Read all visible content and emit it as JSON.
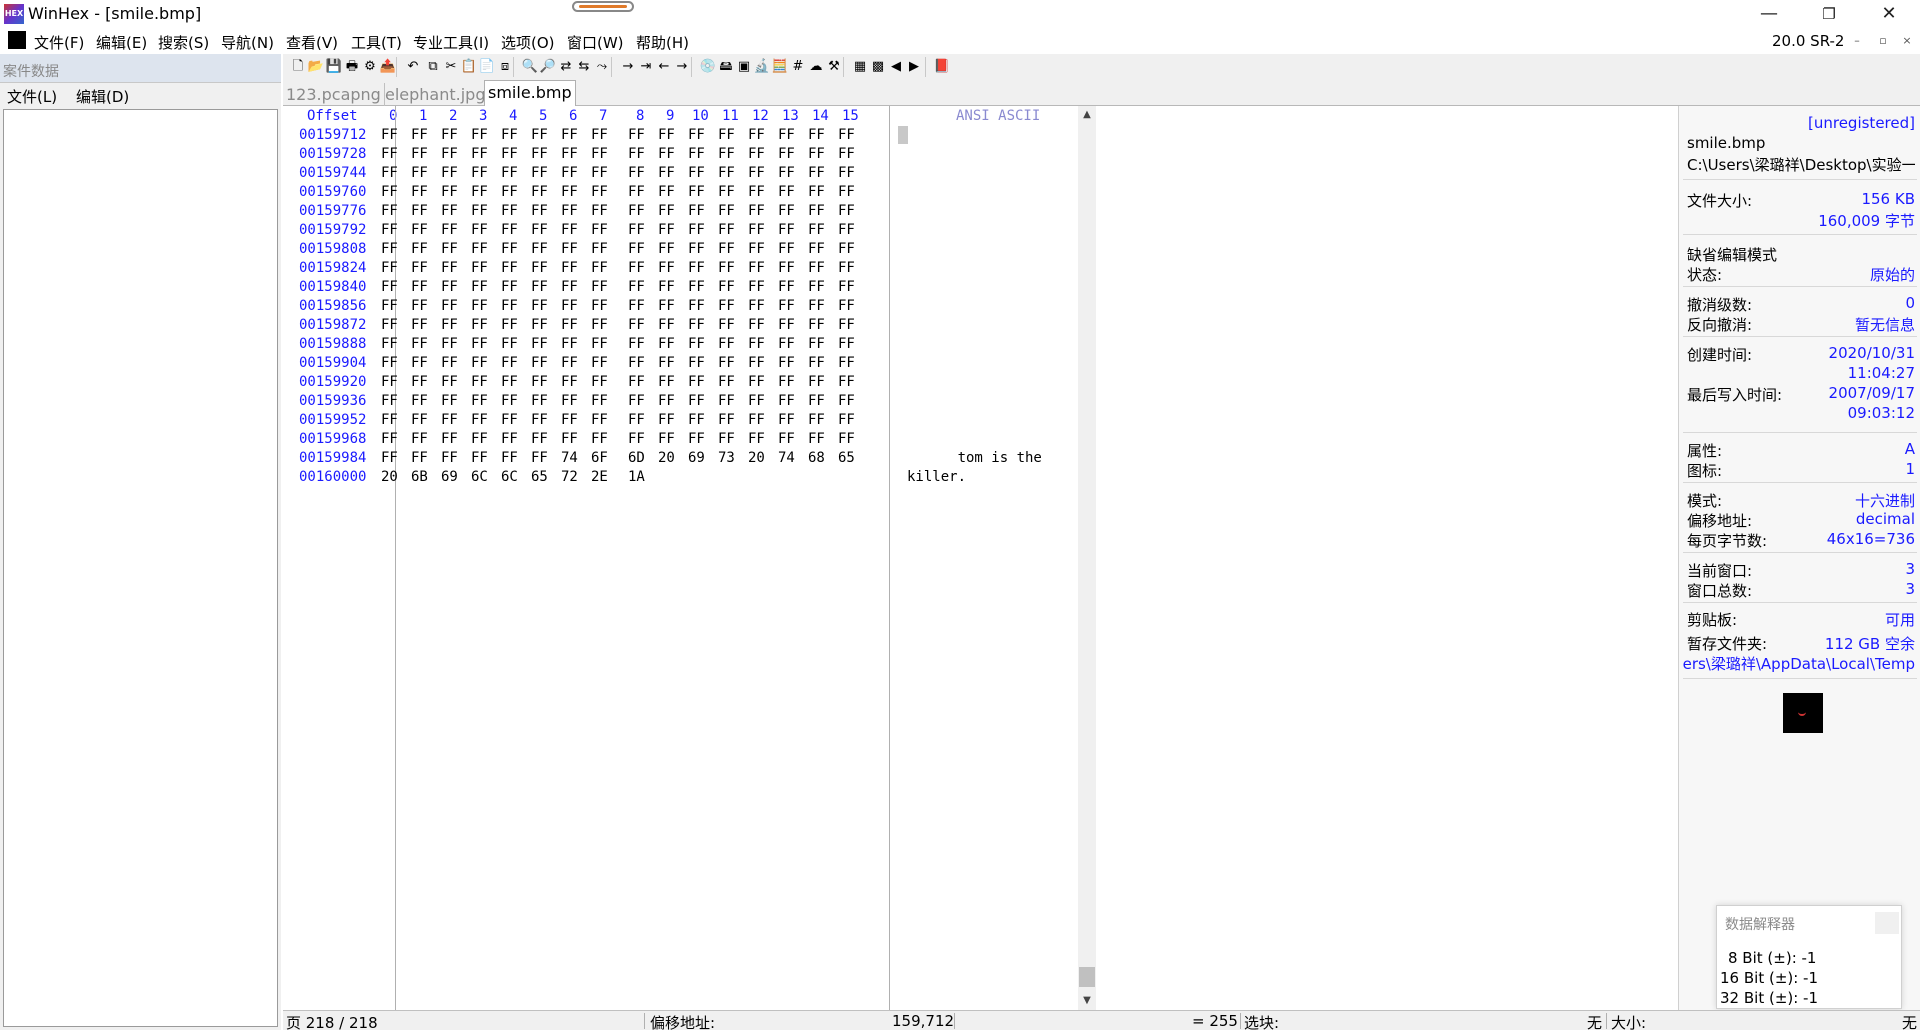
{
  "window": {
    "title": "WinHex - [smile.bmp]",
    "app_icon_text": "HEX",
    "version": "20.0 SR-2",
    "controls": [
      "—",
      "❐",
      "✕"
    ],
    "mdi_controls": [
      "–",
      "▫",
      "×"
    ]
  },
  "menu": [
    "文件(F)",
    "编辑(E)",
    "搜索(S)",
    "导航(N)",
    "查看(V)",
    "工具(T)",
    "专业工具(I)",
    "选项(O)",
    "窗口(W)",
    "帮助(H)"
  ],
  "case_panel": {
    "header": "案件数据",
    "menu": [
      "文件(L)",
      "编辑(D)"
    ]
  },
  "toolbar_icons": [
    "new-file-icon",
    "open-icon",
    "save-icon",
    "print-icon",
    "properties-icon",
    "export-icon",
    "undo-icon",
    "copy-icon",
    "cut-icon",
    "paste-icon",
    "paste-special-icon",
    "hex-copy-icon",
    "find-icon",
    "find-hex-icon",
    "replace-icon",
    "replace-hex-icon",
    "find-next-icon",
    "goto-offset-icon",
    "goto-mark-icon",
    "back-icon",
    "forward-icon",
    "open-disk-icon",
    "disk-edit-icon",
    "ram-icon",
    "analyze-icon",
    "calculator-icon",
    "hash-icon",
    "cloud-icon",
    "tools-icon",
    "pattern-icon",
    "grid-icon",
    "prev-icon",
    "next-icon",
    "book-icon"
  ],
  "tabs": [
    "123.pcapng",
    "elephant.jpg",
    "smile.bmp"
  ],
  "hex": {
    "header_offset": "Offset",
    "columns": [
      "0",
      "1",
      "2",
      "3",
      "4",
      "5",
      "6",
      "7",
      "8",
      "9",
      "10",
      "11",
      "12",
      "13",
      "14",
      "15"
    ],
    "ascii_header": "ANSI ASCII",
    "rows": [
      {
        "offset": "00159712",
        "bytes": [
          "FF",
          "FF",
          "FF",
          "FF",
          "FF",
          "FF",
          "FF",
          "FF",
          "FF",
          "FF",
          "FF",
          "FF",
          "FF",
          "FF",
          "FF",
          "FF"
        ],
        "ascii": ""
      },
      {
        "offset": "00159728",
        "bytes": [
          "FF",
          "FF",
          "FF",
          "FF",
          "FF",
          "FF",
          "FF",
          "FF",
          "FF",
          "FF",
          "FF",
          "FF",
          "FF",
          "FF",
          "FF",
          "FF"
        ],
        "ascii": ""
      },
      {
        "offset": "00159744",
        "bytes": [
          "FF",
          "FF",
          "FF",
          "FF",
          "FF",
          "FF",
          "FF",
          "FF",
          "FF",
          "FF",
          "FF",
          "FF",
          "FF",
          "FF",
          "FF",
          "FF"
        ],
        "ascii": ""
      },
      {
        "offset": "00159760",
        "bytes": [
          "FF",
          "FF",
          "FF",
          "FF",
          "FF",
          "FF",
          "FF",
          "FF",
          "FF",
          "FF",
          "FF",
          "FF",
          "FF",
          "FF",
          "FF",
          "FF"
        ],
        "ascii": ""
      },
      {
        "offset": "00159776",
        "bytes": [
          "FF",
          "FF",
          "FF",
          "FF",
          "FF",
          "FF",
          "FF",
          "FF",
          "FF",
          "FF",
          "FF",
          "FF",
          "FF",
          "FF",
          "FF",
          "FF"
        ],
        "ascii": ""
      },
      {
        "offset": "00159792",
        "bytes": [
          "FF",
          "FF",
          "FF",
          "FF",
          "FF",
          "FF",
          "FF",
          "FF",
          "FF",
          "FF",
          "FF",
          "FF",
          "FF",
          "FF",
          "FF",
          "FF"
        ],
        "ascii": ""
      },
      {
        "offset": "00159808",
        "bytes": [
          "FF",
          "FF",
          "FF",
          "FF",
          "FF",
          "FF",
          "FF",
          "FF",
          "FF",
          "FF",
          "FF",
          "FF",
          "FF",
          "FF",
          "FF",
          "FF"
        ],
        "ascii": ""
      },
      {
        "offset": "00159824",
        "bytes": [
          "FF",
          "FF",
          "FF",
          "FF",
          "FF",
          "FF",
          "FF",
          "FF",
          "FF",
          "FF",
          "FF",
          "FF",
          "FF",
          "FF",
          "FF",
          "FF"
        ],
        "ascii": ""
      },
      {
        "offset": "00159840",
        "bytes": [
          "FF",
          "FF",
          "FF",
          "FF",
          "FF",
          "FF",
          "FF",
          "FF",
          "FF",
          "FF",
          "FF",
          "FF",
          "FF",
          "FF",
          "FF",
          "FF"
        ],
        "ascii": ""
      },
      {
        "offset": "00159856",
        "bytes": [
          "FF",
          "FF",
          "FF",
          "FF",
          "FF",
          "FF",
          "FF",
          "FF",
          "FF",
          "FF",
          "FF",
          "FF",
          "FF",
          "FF",
          "FF",
          "FF"
        ],
        "ascii": ""
      },
      {
        "offset": "00159872",
        "bytes": [
          "FF",
          "FF",
          "FF",
          "FF",
          "FF",
          "FF",
          "FF",
          "FF",
          "FF",
          "FF",
          "FF",
          "FF",
          "FF",
          "FF",
          "FF",
          "FF"
        ],
        "ascii": ""
      },
      {
        "offset": "00159888",
        "bytes": [
          "FF",
          "FF",
          "FF",
          "FF",
          "FF",
          "FF",
          "FF",
          "FF",
          "FF",
          "FF",
          "FF",
          "FF",
          "FF",
          "FF",
          "FF",
          "FF"
        ],
        "ascii": ""
      },
      {
        "offset": "00159904",
        "bytes": [
          "FF",
          "FF",
          "FF",
          "FF",
          "FF",
          "FF",
          "FF",
          "FF",
          "FF",
          "FF",
          "FF",
          "FF",
          "FF",
          "FF",
          "FF",
          "FF"
        ],
        "ascii": ""
      },
      {
        "offset": "00159920",
        "bytes": [
          "FF",
          "FF",
          "FF",
          "FF",
          "FF",
          "FF",
          "FF",
          "FF",
          "FF",
          "FF",
          "FF",
          "FF",
          "FF",
          "FF",
          "FF",
          "FF"
        ],
        "ascii": ""
      },
      {
        "offset": "00159936",
        "bytes": [
          "FF",
          "FF",
          "FF",
          "FF",
          "FF",
          "FF",
          "FF",
          "FF",
          "FF",
          "FF",
          "FF",
          "FF",
          "FF",
          "FF",
          "FF",
          "FF"
        ],
        "ascii": ""
      },
      {
        "offset": "00159952",
        "bytes": [
          "FF",
          "FF",
          "FF",
          "FF",
          "FF",
          "FF",
          "FF",
          "FF",
          "FF",
          "FF",
          "FF",
          "FF",
          "FF",
          "FF",
          "FF",
          "FF"
        ],
        "ascii": ""
      },
      {
        "offset": "00159968",
        "bytes": [
          "FF",
          "FF",
          "FF",
          "FF",
          "FF",
          "FF",
          "FF",
          "FF",
          "FF",
          "FF",
          "FF",
          "FF",
          "FF",
          "FF",
          "FF",
          "FF"
        ],
        "ascii": ""
      },
      {
        "offset": "00159984",
        "bytes": [
          "FF",
          "FF",
          "FF",
          "FF",
          "FF",
          "FF",
          "74",
          "6F",
          "6D",
          "20",
          "69",
          "73",
          "20",
          "74",
          "68",
          "65"
        ],
        "ascii": "      tom is the"
      },
      {
        "offset": "00160000",
        "bytes": [
          "20",
          "6B",
          "69",
          "6C",
          "6C",
          "65",
          "72",
          "2E",
          "1A"
        ],
        "ascii": "killer."
      }
    ]
  },
  "info": {
    "registration": "[unregistered]",
    "filename": "smile.bmp",
    "path": "C:\\Users\\梁璐祥\\Desktop\\实验一\\",
    "rows": [
      {
        "label": "文件大小:",
        "value": "156 KB"
      },
      {
        "label": "",
        "value": "160,009 字节"
      },
      {
        "label": "缺省编辑模式",
        "value": ""
      },
      {
        "label": "状态:",
        "value": "原始的"
      },
      {
        "label": "撤消级数:",
        "value": "0"
      },
      {
        "label": "反向撤消:",
        "value": "暂无信息"
      },
      {
        "label": "创建时间:",
        "value": "2020/10/31"
      },
      {
        "label": "",
        "value": "11:04:27"
      },
      {
        "label": "最后写入时间:",
        "value": "2007/09/17"
      },
      {
        "label": "",
        "value": "09:03:12"
      },
      {
        "label": "属性:",
        "value": "A"
      },
      {
        "label": "图标:",
        "value": "1"
      },
      {
        "label": "模式:",
        "value": "十六进制"
      },
      {
        "label": "偏移地址:",
        "value": "decimal"
      },
      {
        "label": "每页字节数:",
        "value": "46x16=736"
      },
      {
        "label": "当前窗口:",
        "value": "3"
      },
      {
        "label": "窗口总数:",
        "value": "3"
      },
      {
        "label": "剪贴板:",
        "value": "可用"
      },
      {
        "label": "暂存文件夹:",
        "value": "112 GB 空余"
      },
      {
        "label": "",
        "value": "ers\\梁璐祥\\AppData\\Local\\Temp"
      }
    ]
  },
  "interpreter": {
    "title": "数据解释器",
    "lines": [
      "8 Bit (±): -1",
      "16 Bit (±): -1",
      "32 Bit (±): -1"
    ]
  },
  "status": {
    "page": "页 218 / 218",
    "offset_label": "偏移地址:",
    "offset_value": "159,712",
    "value": "= 255",
    "selection_label": "选块:",
    "selection_value": "无",
    "size_label": "大小:",
    "size_value": "无"
  }
}
